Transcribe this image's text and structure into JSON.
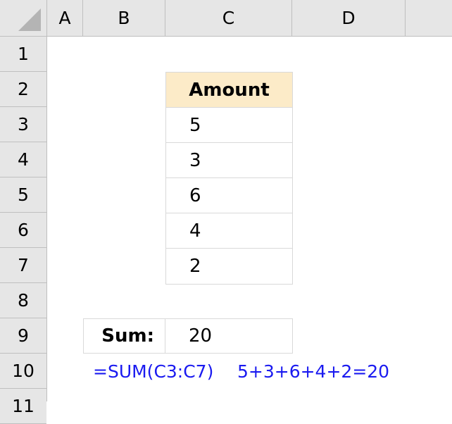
{
  "spreadsheet": {
    "corner": "select-all-corner",
    "column_headers": [
      "A",
      "B",
      "C",
      "D"
    ],
    "row_headers": [
      "1",
      "2",
      "3",
      "4",
      "5",
      "6",
      "7",
      "8",
      "9",
      "10",
      "11"
    ],
    "colors": {
      "header_background": "#e6e6e6",
      "header_gridline": "#bfbfbf",
      "corner_triangle": "#b4b4b4",
      "cell_border": "#d9d9d9",
      "table_header_fill": "#fcebc8",
      "annotation_text": "#1a1af0",
      "sheet_background": "#ffffff"
    }
  },
  "table": {
    "header": "Amount",
    "values": [
      "5",
      "3",
      "6",
      "4",
      "2"
    ]
  },
  "sum": {
    "label": "Sum:",
    "value": "20"
  },
  "annotations": {
    "formula": "=SUM(C3:C7)",
    "expansion": "5+3+6+4+2=20"
  }
}
